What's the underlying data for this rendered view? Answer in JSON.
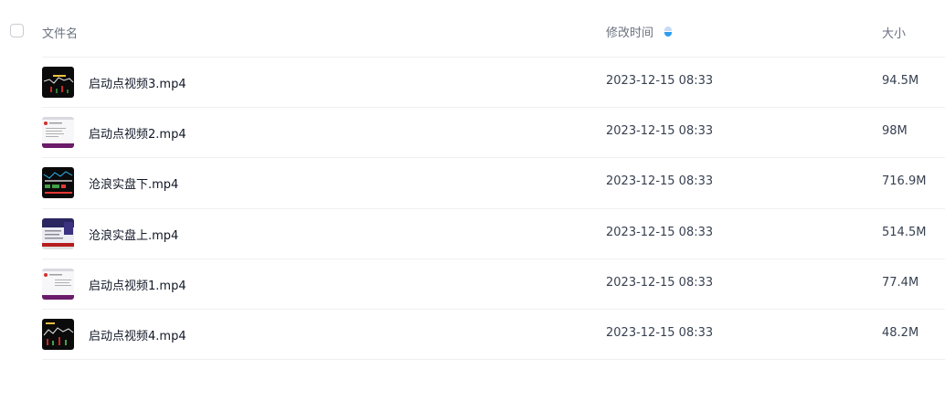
{
  "header": {
    "name_col": "文件名",
    "time_col": "修改时间",
    "size_col": "大小"
  },
  "files": [
    {
      "name": "启动点视频3.mp4",
      "time": "2023-12-15 08:33",
      "size": "94.5M",
      "thumb": "dark-chart"
    },
    {
      "name": "启动点视频2.mp4",
      "time": "2023-12-15 08:33",
      "size": "98M",
      "thumb": "document"
    },
    {
      "name": "沧浪实盘下.mp4",
      "time": "2023-12-15 08:33",
      "size": "716.9M",
      "thumb": "dark-chart-green"
    },
    {
      "name": "沧浪实盘上.mp4",
      "time": "2023-12-15 08:33",
      "size": "514.5M",
      "thumb": "slide"
    },
    {
      "name": "启动点视频1.mp4",
      "time": "2023-12-15 08:33",
      "size": "77.4M",
      "thumb": "document"
    },
    {
      "name": "启动点视频4.mp4",
      "time": "2023-12-15 08:33",
      "size": "48.2M",
      "thumb": "dark-chart"
    }
  ]
}
